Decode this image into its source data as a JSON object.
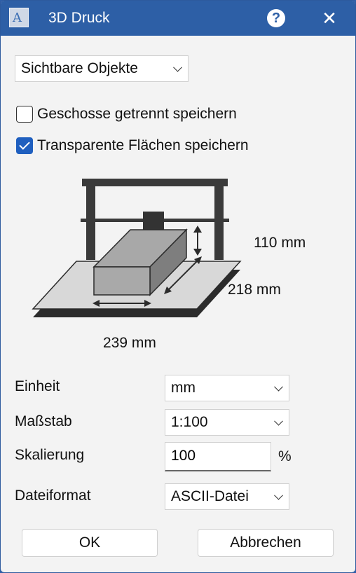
{
  "window": {
    "title": "3D Druck",
    "help_label": "?",
    "close_label": "✕",
    "icon_letter": "A"
  },
  "export_scope": {
    "selected": "Sichtbare Objekte"
  },
  "options": {
    "separate_floors": {
      "label": "Geschosse getrennt speichern",
      "checked": false
    },
    "transparent_surfaces": {
      "label": "Transparente Flächen speichern",
      "checked": true
    }
  },
  "dimensions": {
    "height": "110 mm",
    "depth": "218 mm",
    "width": "239 mm"
  },
  "settings": {
    "unit": {
      "label": "Einheit",
      "value": "mm"
    },
    "scale": {
      "label": "Maßstab",
      "value": "1:100"
    },
    "scaling": {
      "label": "Skalierung",
      "value": "100",
      "suffix": "%"
    },
    "file_format": {
      "label": "Dateiformat",
      "value": "ASCII-Datei"
    }
  },
  "buttons": {
    "ok": "OK",
    "cancel": "Abbrechen"
  },
  "colors": {
    "titlebar": "#2d5fa6",
    "checkbox_accent": "#1f5fbf"
  }
}
